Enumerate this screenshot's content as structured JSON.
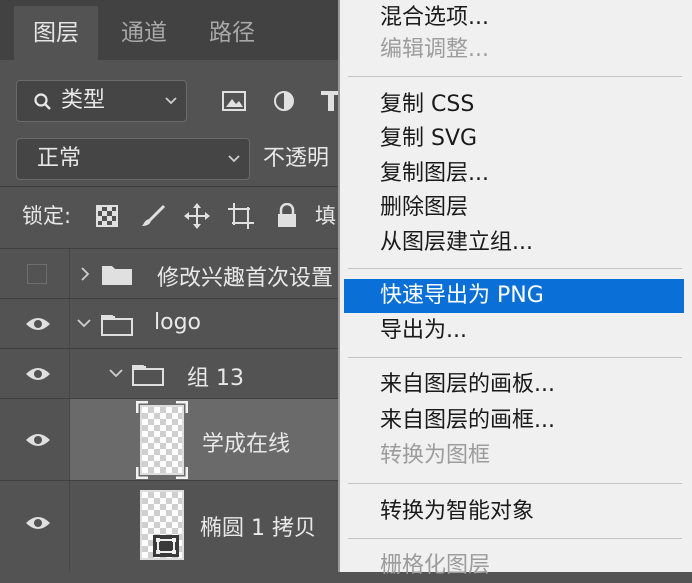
{
  "tabs": [
    "图层",
    "通道",
    "路径"
  ],
  "filter": {
    "label": "类型"
  },
  "blend": {
    "mode": "正常",
    "opacity_label": "不透明"
  },
  "lock": {
    "label": "锁定:",
    "fill_label": "填"
  },
  "layers": [
    {
      "name": "修改兴趣首次设置",
      "type": "group",
      "visible": false,
      "expanded": false
    },
    {
      "name": "logo",
      "type": "group",
      "visible": true,
      "expanded": true
    },
    {
      "name": "组 13",
      "type": "group",
      "visible": true,
      "expanded": true
    },
    {
      "name": "学成在线",
      "type": "layer",
      "visible": true,
      "selected": true
    },
    {
      "name": "椭圆 1 拷贝",
      "type": "shape",
      "visible": true
    }
  ],
  "menu": {
    "items": [
      {
        "label": "混合选项...",
        "disabled": false
      },
      {
        "label": "编辑调整...",
        "disabled": true
      },
      {
        "label": "复制 CSS",
        "disabled": false
      },
      {
        "label": "复制 SVG",
        "disabled": false
      },
      {
        "label": "复制图层...",
        "disabled": false
      },
      {
        "label": "删除图层",
        "disabled": false
      },
      {
        "label": "从图层建立组...",
        "disabled": false
      },
      {
        "label": "快速导出为 PNG",
        "disabled": false,
        "highlighted": true
      },
      {
        "label": "导出为...",
        "disabled": false
      },
      {
        "label": "来自图层的画板...",
        "disabled": false
      },
      {
        "label": "来自图层的画框...",
        "disabled": false
      },
      {
        "label": "转换为图框",
        "disabled": true
      },
      {
        "label": "转换为智能对象",
        "disabled": false
      },
      {
        "label": "栅格化图层",
        "disabled": true
      }
    ]
  },
  "colors": {
    "panel_bg": "#535353",
    "menu_bg": "#f0f0f0",
    "highlight": "#0a6fd6"
  }
}
